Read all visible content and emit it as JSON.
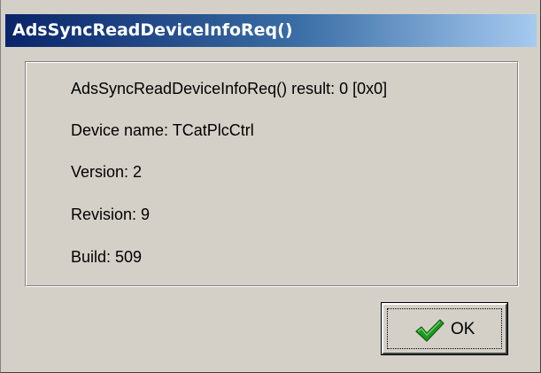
{
  "window": {
    "title": "AdsSyncReadDeviceInfoReq()"
  },
  "info": {
    "result_line": "AdsSyncReadDeviceInfoReq() result: 0 [0x0]",
    "device_name_line": "Device name: TCatPlcCtrl",
    "version_line": "Version: 2",
    "revision_line": "Revision: 9",
    "build_line": "Build: 509"
  },
  "buttons": {
    "ok_label": "OK",
    "ok_icon": "checkmark-icon"
  },
  "colors": {
    "title_gradient_start": "#0a246a",
    "title_gradient_end": "#a6caf0",
    "dialog_background": "#d4d0c8",
    "check_green": "#1f9a1f"
  }
}
